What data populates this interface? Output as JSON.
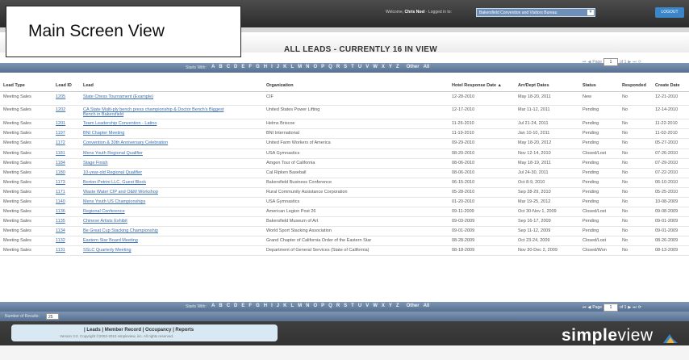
{
  "callout": "Main Screen View",
  "header": {
    "welcome_prefix": "Welcome, ",
    "welcome_user": "Chris Noel",
    "welcome_suffix": " · Logged in to:",
    "org": "Bakersfield Convention and Visitors Bureau",
    "logout": "LOGOUT"
  },
  "view_title": "ALL LEADS - CURRENTLY 16 IN VIEW",
  "pager": {
    "first": "⏮",
    "prev": "◀",
    "page_label": "Page",
    "page": "1",
    "of": "of 1",
    "next": "▶",
    "last": "⏭",
    "refresh": "⟳"
  },
  "alpha": {
    "label": "Starts With:",
    "letters": [
      "A",
      "B",
      "C",
      "D",
      "E",
      "F",
      "G",
      "H",
      "I",
      "J",
      "K",
      "L",
      "M",
      "N",
      "O",
      "P",
      "Q",
      "R",
      "S",
      "T",
      "U",
      "V",
      "W",
      "X",
      "Y",
      "Z",
      "Other",
      "All"
    ]
  },
  "columns": [
    "Lead Type",
    "Lead ID",
    "Lead",
    "Organization",
    "Hotel Response Date",
    "Arr/Dept Dates",
    "Status",
    "Responded",
    "Create Date"
  ],
  "sort_indicator": "▲",
  "rows": [
    {
      "type": "Meeting Sales",
      "id": "1205",
      "lead": "State Chess Tournament (Example)",
      "org": "CIF",
      "hotel": "12-28-2010",
      "dates": "May 18-20, 2011",
      "status": "New",
      "responded": "No",
      "created": "12-21-2010"
    },
    {
      "type": "Meeting Sales",
      "id": "1202",
      "lead": "CA State Multi-ply bench press championship & Doctor Bench's Biggest Bench in Bakersfield",
      "org": "United States Power Lifting",
      "hotel": "12-17-2010",
      "dates": "Mar 11-12, 2011",
      "status": "Pending",
      "responded": "No",
      "created": "12-14-2010"
    },
    {
      "type": "Meeting Sales",
      "id": "1201",
      "lead": "Team Leadership Convention - Latino",
      "org": "Helms Briscoe",
      "hotel": "11-26-2010",
      "dates": "Jul 21-24, 2011",
      "status": "Pending",
      "responded": "No",
      "created": "11-22-2010"
    },
    {
      "type": "Meeting Sales",
      "id": "1197",
      "lead": "BNI Chapter Meeting",
      "org": "BNI International",
      "hotel": "11-19-2010",
      "dates": "Jan 10-10, 2011",
      "status": "Pending",
      "responded": "No",
      "created": "11-02-2010"
    },
    {
      "type": "Meeting Sales",
      "id": "1172",
      "lead": "Convention & 30th Anniversary Celebration",
      "org": "United Farm Workers of America",
      "hotel": "09-29-2010",
      "dates": "May 18-20, 2012",
      "status": "Pending",
      "responded": "No",
      "created": "05-27-2010"
    },
    {
      "type": "Meeting Sales",
      "id": "1181",
      "lead": "Mens Youth Regional Qualifier",
      "org": "USA Gymnastics",
      "hotel": "08-20-2010",
      "dates": "Nov 12-14, 2010",
      "status": "Closed/Lost",
      "responded": "No",
      "created": "07-26-2010"
    },
    {
      "type": "Meeting Sales",
      "id": "1184",
      "lead": "Stage Finish",
      "org": "Amgen Tour of California",
      "hotel": "08-06-2010",
      "dates": "May 18-19, 2011",
      "status": "Pending",
      "responded": "No",
      "created": "07-29-2010"
    },
    {
      "type": "Meeting Sales",
      "id": "1180",
      "lead": "10-year-old Regional Qualifier",
      "org": "Cal Ripken Baseball",
      "hotel": "08-06-2010",
      "dates": "Jul 24-30, 2011",
      "status": "Pending",
      "responded": "No",
      "created": "07-22-2010"
    },
    {
      "type": "Meeting Sales",
      "id": "1173",
      "lead": "Borton-Petrini LLC, Guest Block",
      "org": "Bakersfield Business Conference",
      "hotel": "06-15-2010",
      "dates": "Oct 8-9, 2010",
      "status": "Pending",
      "responded": "No",
      "created": "06-10-2010"
    },
    {
      "type": "Meeting Sales",
      "id": "1171",
      "lead": "Waste Water CIP and O&M Workshop",
      "org": "Rural Community Assistance Corporation",
      "hotel": "05-28-2010",
      "dates": "Sep 28-29, 2010",
      "status": "Pending",
      "responded": "No",
      "created": "05-25-2010"
    },
    {
      "type": "Meeting Sales",
      "id": "1140",
      "lead": "Mens Youth US Championships",
      "org": "USA Gymnastics",
      "hotel": "01-20-2010",
      "dates": "Mar 19-25, 2012",
      "status": "Pending",
      "responded": "No",
      "created": "10-08-2009"
    },
    {
      "type": "Meeting Sales",
      "id": "1136",
      "lead": "Regional Conference",
      "org": "American Legion Post 26",
      "hotel": "09-11-2009",
      "dates": "Oct 30-Nov 1, 2009",
      "status": "Closed/Lost",
      "responded": "No",
      "created": "09-08-2009"
    },
    {
      "type": "Meeting Sales",
      "id": "1135",
      "lead": "Chinese Artists Exhibit",
      "org": "Bakersfield Museum of Art",
      "hotel": "09-03-2009",
      "dates": "Sep 16-17, 2009",
      "status": "Pending",
      "responded": "No",
      "created": "09-01-2009"
    },
    {
      "type": "Meeting Sales",
      "id": "1134",
      "lead": "Be Great Cup Stacking Championship",
      "org": "World Sport Stacking Association",
      "hotel": "09-01-2009",
      "dates": "Sep 11-12, 2009",
      "status": "Pending",
      "responded": "No",
      "created": "09-01-2009"
    },
    {
      "type": "Meeting Sales",
      "id": "1132",
      "lead": "Eastern Star Board Meeting",
      "org": "Grand Chapter of California Order of the Eastern Star",
      "hotel": "08-28-2009",
      "dates": "Oct 23-24, 2009",
      "status": "Closed/Lost",
      "responded": "No",
      "created": "08-26-2009"
    },
    {
      "type": "Meeting Sales",
      "id": "1131",
      "lead": "SSLC Quarterly Meeting",
      "org": "Department of General Services (State of California)",
      "hotel": "08-18-2009",
      "dates": "Nov 30-Dec 2, 2009",
      "status": "Closed/Won",
      "responded": "No",
      "created": "08-13-2009"
    }
  ],
  "per_page": {
    "label": "Number of Results:",
    "value": "25"
  },
  "footer": {
    "links": "| Leads | Member Record | Occupancy | Reports",
    "copyright": "Version 3.0. Copyright ©2003-2010 simpleview, inc. All rights reserved.",
    "brand_a": "simple",
    "brand_b": "view"
  }
}
